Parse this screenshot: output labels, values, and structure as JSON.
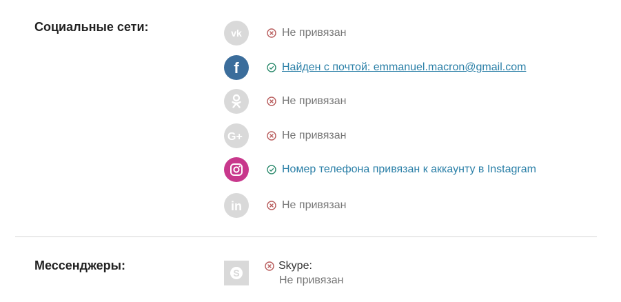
{
  "social": {
    "title": "Социальные сети:",
    "rows": [
      {
        "network": "vk-icon",
        "state": "negative",
        "text": "Не привязан"
      },
      {
        "network": "facebook-icon",
        "state": "link",
        "text": "Найден с почтой: emmanuel.macron@gmail.com"
      },
      {
        "network": "odnoklassniki-icon",
        "state": "negative",
        "text": "Не привязан"
      },
      {
        "network": "google-plus-icon",
        "state": "negative",
        "text": "Не привязан"
      },
      {
        "network": "instagram-icon",
        "state": "positive",
        "text": "Номер телефона привязан к аккаунту в Instagram"
      },
      {
        "network": "linkedin-icon",
        "state": "negative",
        "text": "Не привязан"
      }
    ]
  },
  "messengers": {
    "title": "Мессенджеры:",
    "items": [
      {
        "network": "skype-icon",
        "name": "Skype:",
        "status": "Не привязан"
      }
    ]
  },
  "colors": {
    "inactive_icon": "#d9d9d9",
    "facebook": "#3b6d9b",
    "instagram": "#c8388c",
    "negative_status": "#b85c5c",
    "positive_status": "#2e8b6e",
    "link_text": "#2a7fa7",
    "muted_text": "#777777",
    "divider": "#d6d6d6"
  }
}
